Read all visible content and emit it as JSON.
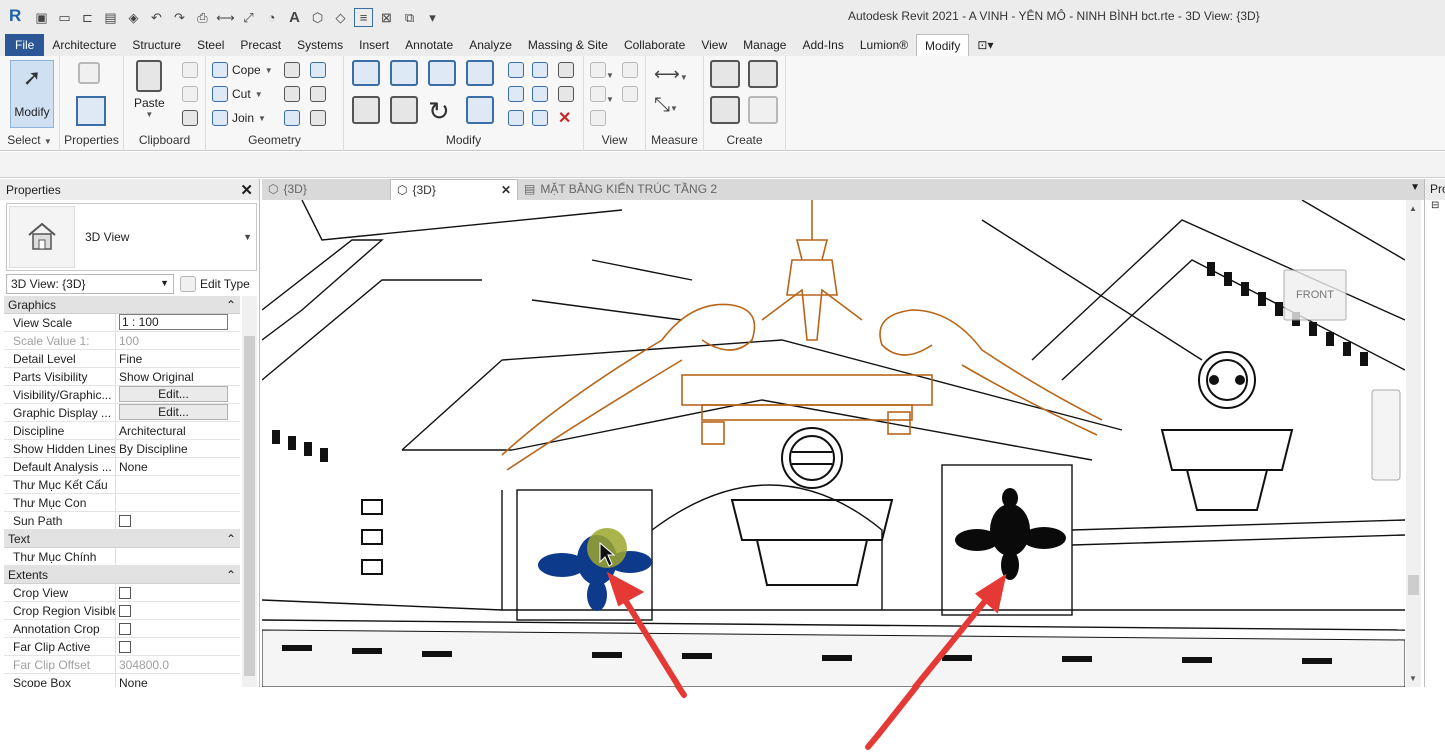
{
  "title_bar": {
    "logo": "R",
    "window_title": "Autodesk Revit 2021 - A VINH - YÊN MÔ - NINH BÌNH bct.rte - 3D View: {3D}",
    "quick_access_text": "A"
  },
  "ribbon_tabs": [
    {
      "label": "File"
    },
    {
      "label": "Architecture"
    },
    {
      "label": "Structure"
    },
    {
      "label": "Steel"
    },
    {
      "label": "Precast"
    },
    {
      "label": "Systems"
    },
    {
      "label": "Insert"
    },
    {
      "label": "Annotate"
    },
    {
      "label": "Analyze"
    },
    {
      "label": "Massing & Site"
    },
    {
      "label": "Collaborate"
    },
    {
      "label": "View"
    },
    {
      "label": "Manage"
    },
    {
      "label": "Add-Ins"
    },
    {
      "label": "Lumion®"
    },
    {
      "label": "Modify"
    }
  ],
  "ribbon": {
    "select_panel": {
      "modify_label": "Modify",
      "panel_label": "Select"
    },
    "properties_panel": {
      "panel_label": "Properties"
    },
    "clipboard_panel": {
      "paste_label": "Paste",
      "panel_label": "Clipboard"
    },
    "geometry_panel": {
      "cope_label": "Cope",
      "cut_label": "Cut",
      "join_label": "Join",
      "panel_label": "Geometry"
    },
    "modify_panel": {
      "panel_label": "Modify"
    },
    "view_panel": {
      "panel_label": "View"
    },
    "measure_panel": {
      "panel_label": "Measure"
    },
    "create_panel": {
      "panel_label": "Create"
    }
  },
  "properties_palette": {
    "title": "Properties",
    "type_name": "3D View",
    "instance_selector": "3D View: {3D}",
    "edit_type_label": "Edit Type",
    "sections": [
      {
        "name": "Graphics",
        "rows": [
          {
            "name": "View Scale",
            "value": "1 : 100",
            "style": "boxed"
          },
          {
            "name": "Scale Value    1:",
            "value": "100",
            "style": "dim"
          },
          {
            "name": "Detail Level",
            "value": "Fine"
          },
          {
            "name": "Parts Visibility",
            "value": "Show Original"
          },
          {
            "name": "Visibility/Graphic...",
            "value": "Edit...",
            "style": "button"
          },
          {
            "name": "Graphic Display ...",
            "value": "Edit...",
            "style": "button"
          },
          {
            "name": "Discipline",
            "value": "Architectural"
          },
          {
            "name": "Show Hidden Lines",
            "value": "By Discipline"
          },
          {
            "name": "Default Analysis ...",
            "value": "None"
          },
          {
            "name": "Thư Mục Kết Cấu",
            "value": ""
          },
          {
            "name": "Thư Mục Con",
            "value": ""
          },
          {
            "name": "Sun Path",
            "value": "",
            "style": "checkbox"
          }
        ]
      },
      {
        "name": "Text",
        "rows": [
          {
            "name": "Thư Mục Chính",
            "value": ""
          }
        ]
      },
      {
        "name": "Extents",
        "rows": [
          {
            "name": "Crop View",
            "value": "",
            "style": "checkbox"
          },
          {
            "name": "Crop Region Visible",
            "value": "",
            "style": "checkbox"
          },
          {
            "name": "Annotation Crop",
            "value": "",
            "style": "checkbox"
          },
          {
            "name": "Far Clip Active",
            "value": "",
            "style": "checkbox"
          },
          {
            "name": "Far Clip Offset",
            "value": "304800.0",
            "style": "dim"
          },
          {
            "name": "Scope Box",
            "value": "None"
          }
        ]
      }
    ]
  },
  "view_tabs": [
    {
      "label": "{3D}",
      "active": false
    },
    {
      "label": "{3D}",
      "active": true
    },
    {
      "label": "MẶT BẰNG KIẾN TRÚC TẦNG 2",
      "active": false
    }
  ],
  "viewcube": {
    "face_label": "FRONT"
  },
  "project_browser": {
    "title": "Pro"
  },
  "colors": {
    "file_tab": "#2b5797",
    "selected_element": "#b8651a",
    "highlight_ornament": "#0d3a8a",
    "annotation_arrow": "#e53935"
  }
}
